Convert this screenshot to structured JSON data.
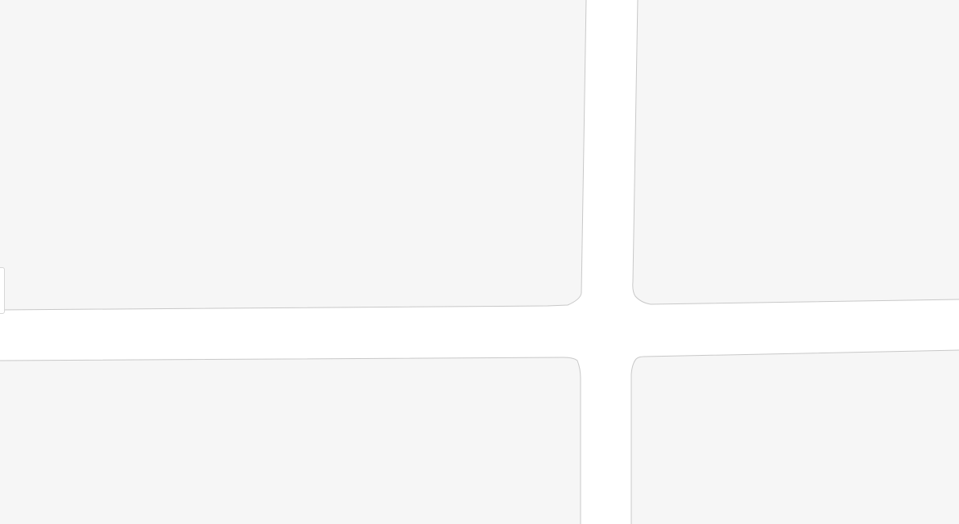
{
  "map": {
    "background_color": "#ffffff",
    "block_fill_color": "#f6f6f6",
    "block_stroke_color": "#c8c8c8",
    "blocks": [
      {
        "name": "city-block-north-west"
      },
      {
        "name": "city-block-north-east"
      },
      {
        "name": "city-block-south-west"
      },
      {
        "name": "city-block-south-east"
      }
    ],
    "streets": [
      {
        "name": "street-horizontal"
      },
      {
        "name": "street-vertical"
      }
    ],
    "edge_control": {
      "name": "map-edge-control-tab"
    }
  }
}
